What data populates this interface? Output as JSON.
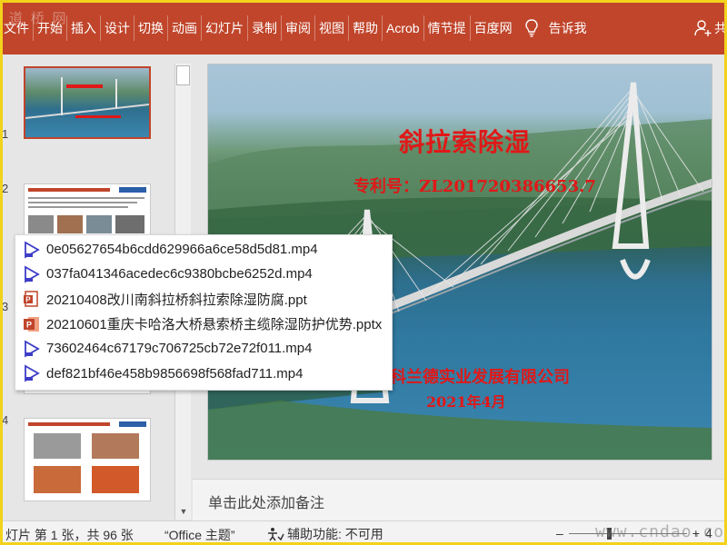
{
  "ribbon": {
    "tabs": [
      "文件",
      "开始",
      "插入",
      "设计",
      "切换",
      "动画",
      "幻灯片",
      "录制",
      "审阅",
      "视图",
      "帮助",
      "Acrob",
      "情节提",
      "百度网"
    ],
    "tell_me": "告诉我",
    "share": "共",
    "watermark": "道 桥 网",
    "color": "#c0452b"
  },
  "thumbnails": {
    "numbers": [
      "1",
      "2",
      "3",
      "4"
    ]
  },
  "slide": {
    "title": "斜拉索除湿",
    "patent": "专利号：ZL201720386653.7",
    "company": "科兰德实业发展有限公司",
    "date": "2021年4月",
    "text_color": "#e01818"
  },
  "notes": {
    "placeholder": "单击此处添加备注"
  },
  "status": {
    "slide_info": "灯片 第 1 张，共 96 张",
    "theme": "“Office 主题”",
    "accessibility": "辅助功能: 不可用",
    "zoom_level": "4",
    "watermark": "www.cndao.com"
  },
  "popup": {
    "files": [
      {
        "name": "0e05627654b6cdd629966a6ce58d5d81.mp4",
        "type": "mp4"
      },
      {
        "name": "037fa041346acedec6c9380bcbe6252d.mp4",
        "type": "mp4"
      },
      {
        "name": "20210408改川南斜拉桥斜拉索除湿防腐.ppt",
        "type": "ppt"
      },
      {
        "name": "20210601重庆卡哈洛大桥悬索桥主缆除湿防护优势.pptx",
        "type": "pptx"
      },
      {
        "name": "73602464c67179c706725cb72e72f011.mp4",
        "type": "mp4"
      },
      {
        "name": "def821bf46e458b9856698f568fad711.mp4",
        "type": "mp4"
      }
    ]
  }
}
